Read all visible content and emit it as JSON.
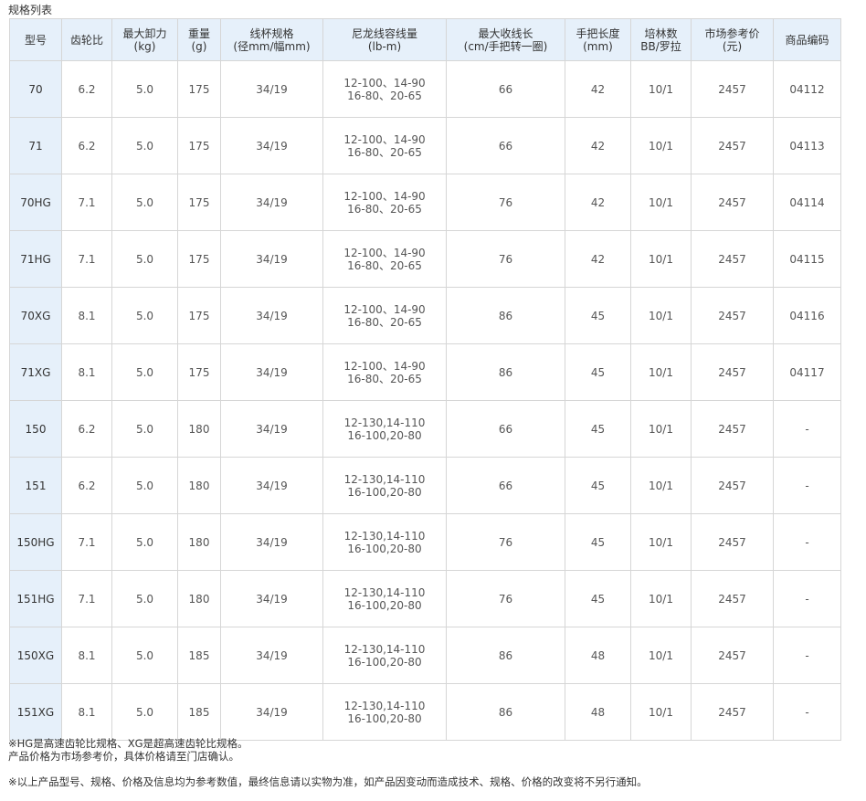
{
  "title": "规格列表",
  "table": {
    "headers": [
      {
        "line1": "型号",
        "line2": ""
      },
      {
        "line1": "齿轮比",
        "line2": ""
      },
      {
        "line1": "最大卸力",
        "line2": "(kg)"
      },
      {
        "line1": "重量",
        "line2": "(g)"
      },
      {
        "line1": "线杯规格",
        "line2": "(径mm/幅mm)"
      },
      {
        "line1": "尼龙线容线量",
        "line2": "(lb-m)"
      },
      {
        "line1": "最大收线长",
        "line2": "(cm/手把转一圈)"
      },
      {
        "line1": "手把长度",
        "line2": "(mm)"
      },
      {
        "line1": "培林数",
        "line2": "BB/罗拉"
      },
      {
        "line1": "市场参考价",
        "line2": "(元)"
      },
      {
        "line1": "商品编码",
        "line2": ""
      }
    ],
    "rows": [
      {
        "model": "70",
        "gear": "6.2",
        "drag": "5.0",
        "weight": "175",
        "spool": "34/19",
        "line1": "12-100、14-90",
        "line2": "16-80、20-65",
        "retrieve": "66",
        "handle": "42",
        "bearings": "10/1",
        "price": "2457",
        "code": "04112"
      },
      {
        "model": "71",
        "gear": "6.2",
        "drag": "5.0",
        "weight": "175",
        "spool": "34/19",
        "line1": "12-100、14-90",
        "line2": "16-80、20-65",
        "retrieve": "66",
        "handle": "42",
        "bearings": "10/1",
        "price": "2457",
        "code": "04113"
      },
      {
        "model": "70HG",
        "gear": "7.1",
        "drag": "5.0",
        "weight": "175",
        "spool": "34/19",
        "line1": "12-100、14-90",
        "line2": "16-80、20-65",
        "retrieve": "76",
        "handle": "42",
        "bearings": "10/1",
        "price": "2457",
        "code": "04114"
      },
      {
        "model": "71HG",
        "gear": "7.1",
        "drag": "5.0",
        "weight": "175",
        "spool": "34/19",
        "line1": "12-100、14-90",
        "line2": "16-80、20-65",
        "retrieve": "76",
        "handle": "42",
        "bearings": "10/1",
        "price": "2457",
        "code": "04115"
      },
      {
        "model": "70XG",
        "gear": "8.1",
        "drag": "5.0",
        "weight": "175",
        "spool": "34/19",
        "line1": "12-100、14-90",
        "line2": "16-80、20-65",
        "retrieve": "86",
        "handle": "45",
        "bearings": "10/1",
        "price": "2457",
        "code": "04116"
      },
      {
        "model": "71XG",
        "gear": "8.1",
        "drag": "5.0",
        "weight": "175",
        "spool": "34/19",
        "line1": "12-100、14-90",
        "line2": "16-80、20-65",
        "retrieve": "86",
        "handle": "45",
        "bearings": "10/1",
        "price": "2457",
        "code": "04117"
      },
      {
        "model": "150",
        "gear": "6.2",
        "drag": "5.0",
        "weight": "180",
        "spool": "34/19",
        "line1": "12-130,14-110",
        "line2": "16-100,20-80",
        "retrieve": "66",
        "handle": "45",
        "bearings": "10/1",
        "price": "2457",
        "code": "-"
      },
      {
        "model": "151",
        "gear": "6.2",
        "drag": "5.0",
        "weight": "180",
        "spool": "34/19",
        "line1": "12-130,14-110",
        "line2": "16-100,20-80",
        "retrieve": "66",
        "handle": "45",
        "bearings": "10/1",
        "price": "2457",
        "code": "-"
      },
      {
        "model": "150HG",
        "gear": "7.1",
        "drag": "5.0",
        "weight": "180",
        "spool": "34/19",
        "line1": "12-130,14-110",
        "line2": "16-100,20-80",
        "retrieve": "76",
        "handle": "45",
        "bearings": "10/1",
        "price": "2457",
        "code": "-"
      },
      {
        "model": "151HG",
        "gear": "7.1",
        "drag": "5.0",
        "weight": "180",
        "spool": "34/19",
        "line1": "12-130,14-110",
        "line2": "16-100,20-80",
        "retrieve": "76",
        "handle": "45",
        "bearings": "10/1",
        "price": "2457",
        "code": "-"
      },
      {
        "model": "150XG",
        "gear": "8.1",
        "drag": "5.0",
        "weight": "185",
        "spool": "34/19",
        "line1": "12-130,14-110",
        "line2": "16-100,20-80",
        "retrieve": "86",
        "handle": "48",
        "bearings": "10/1",
        "price": "2457",
        "code": "-"
      },
      {
        "model": "151XG",
        "gear": "8.1",
        "drag": "5.0",
        "weight": "185",
        "spool": "34/19",
        "line1": "12-130,14-110",
        "line2": "16-100,20-80",
        "retrieve": "86",
        "handle": "48",
        "bearings": "10/1",
        "price": "2457",
        "code": "-"
      }
    ]
  },
  "notes": {
    "hg_xg": "※HG是高速齿轮比规格、XG是超高速齿轮比规格。",
    "price": "产品价格为市场参考价，具体价格请至门店确认。",
    "disclaimer": "※以上产品型号、规格、价格及信息均为参考数值，最终信息请以实物为准，如产品因变动而造成技术、规格、价格的改变将不另行通知。"
  },
  "colors": {
    "header_bg": "#e6f0fa",
    "model_col_bg": "#e6f0fa",
    "border": "#d6d6d6",
    "text": "#333333"
  }
}
